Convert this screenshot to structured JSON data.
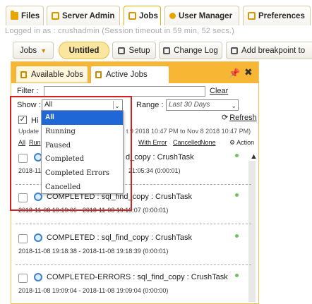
{
  "topnav": {
    "tabs": [
      {
        "label": "Files",
        "icon": "folder-icon"
      },
      {
        "label": "Server Admin",
        "icon": "server-icon"
      },
      {
        "label": "Jobs",
        "icon": "jobs-icon"
      },
      {
        "label": "User Manager",
        "icon": "user-icon"
      },
      {
        "label": "Preferences",
        "icon": "preferences-icon"
      }
    ],
    "active": "Jobs"
  },
  "session": {
    "text": "Logged in as : crushadmin  (Session timeout in 59 min, 52 secs.)"
  },
  "toolbar": {
    "jobs_label": "Jobs",
    "untitled_label": "Untitled",
    "setup_label": "Setup",
    "changelog_label": "Change Log",
    "breakpoint_label": "Add breakpoint to"
  },
  "panel": {
    "tabs": {
      "available": "Available Jobs",
      "active": "Active Jobs"
    },
    "filter_label": "Filter :",
    "clear_label": "Clear",
    "show_label": "Show :",
    "show_value": "All",
    "range_label": "Range :",
    "range_value": "Last 30 Days",
    "refresh_label": "Refresh",
    "hide_label": "Hi",
    "updated_prefix": "Update",
    "updated_range": "t 9 2018 10:47 PM to Nov 8 2018 10:47 PM)",
    "filters": {
      "all": "All",
      "run": "Run",
      "with_error": "With Error",
      "cancelled": "Cancelled",
      "none": "None"
    },
    "action_label": "Action",
    "dropdown_options": [
      "All",
      "Running",
      "Paused",
      "Completed",
      "Completed Errors",
      "Cancelled"
    ],
    "dropdown_selected": "All"
  },
  "jobs": [
    {
      "title": "d_copy : CrushTask",
      "times": "2018-11-",
      "times_tail": "21:05:34 (0:00:01)"
    },
    {
      "title": "COMPLETED : sql_find_copy : CrushTask",
      "times": "2018-11-08 19:19:06 - 2018-11-08 19:19:07 (0:00:01)"
    },
    {
      "title": "COMPLETED : sql_find_copy : CrushTask",
      "times": "2018-11-08 19:18:38 - 2018-11-08 19:18:39 (0:00:01)"
    },
    {
      "title": "COMPLETED-ERRORS : sql_find_copy : CrushTask",
      "times": "2018-11-08 19:09:04 - 2018-11-08 19:09:04 (0:00:00)"
    }
  ],
  "colors": {
    "accent": "#f7b633",
    "selection": "#1f66d6",
    "highlight_box": "#d42020"
  }
}
